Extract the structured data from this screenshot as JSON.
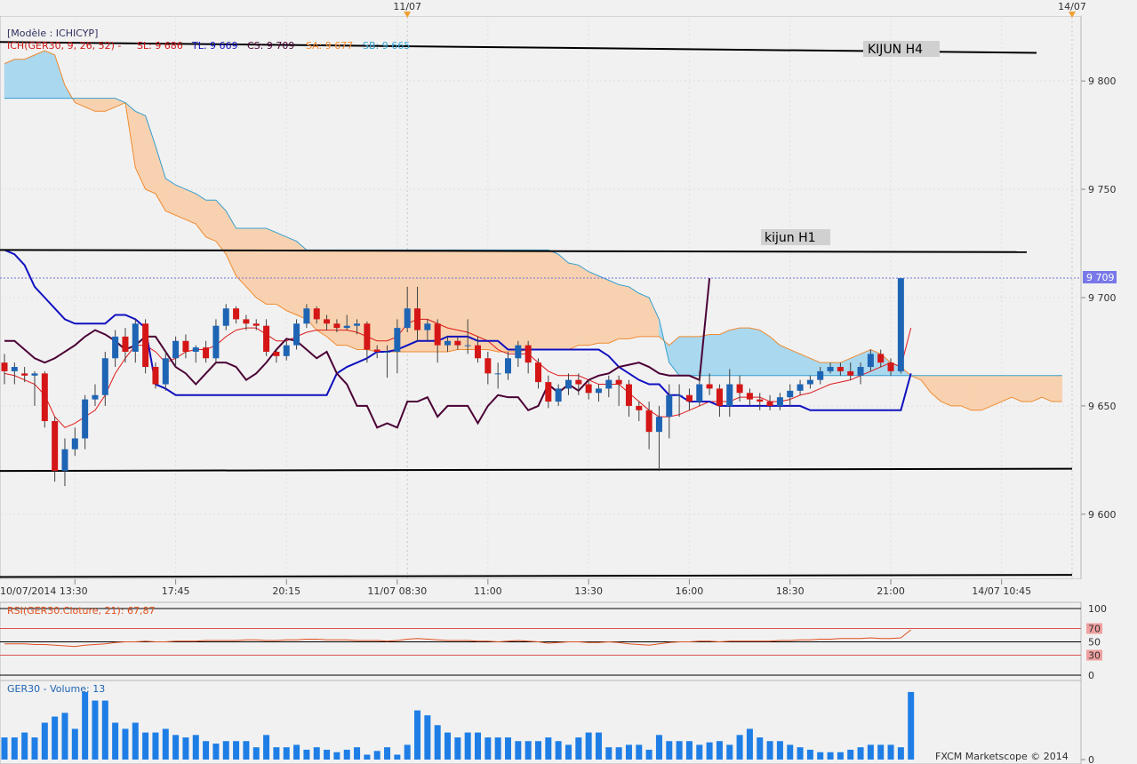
{
  "top_dates": [
    {
      "label": "11/07",
      "index": 40
    },
    {
      "label": "14/07",
      "index": 106
    }
  ],
  "legend": {
    "model": "[Modèle : ICHICYP]",
    "ich_params": "ICH(GER30, 9, 26, 52) -",
    "sl": "SL: 9 686",
    "tl": "TL: 9 669",
    "cs": "CS: 9 709",
    "sa": "SA: 9 677",
    "sb": "SB: 9 665"
  },
  "annotations": {
    "kijun_h4": "KIJUN H4",
    "kijun_h1": "kijun H1"
  },
  "price_axis": {
    "ticks": [
      "9 800",
      "9 750",
      "9 700",
      "9 650",
      "9 600"
    ],
    "current_label": "9 709"
  },
  "time_axis": [
    "10/07/2014 13:30",
    "17:45",
    "20:15",
    "11/07 08:30",
    "11:00",
    "13:30",
    "16:00",
    "18:30",
    "21:00",
    "14/07 10:45"
  ],
  "rsi": {
    "title": "RSI(GER30.Cloture, 21): 67,87",
    "levels": [
      "100",
      "70",
      "50",
      "30",
      "0"
    ]
  },
  "volume": {
    "title": "GER30 - Volume: 13"
  },
  "copyright": "FXCM Marketscope © 2014",
  "colors": {
    "bull": "#1e64b4",
    "bear": "#d51616",
    "tenkan": "#e01818",
    "kijun": "#1010c0",
    "chikou": "#4b0036",
    "senkou_a": "#f08a30",
    "senkou_b": "#38a0d0",
    "cloud_bear": "#f8d2b0",
    "cloud_bull": "#aad8ee",
    "volume": "#1e7ee6"
  },
  "chart_data": {
    "type": "candlestick",
    "symbol": "GER30",
    "y_range": [
      9570,
      9830
    ],
    "candles": [
      [
        9670,
        9674,
        9660,
        9666
      ],
      [
        9666,
        9670,
        9660,
        9668
      ],
      [
        9665,
        9668,
        9661,
        9664
      ],
      [
        9664,
        9666,
        9650,
        9665
      ],
      [
        9665,
        9666,
        9640,
        9643
      ],
      [
        9643,
        9645,
        9615,
        9620
      ],
      [
        9620,
        9635,
        9613,
        9630
      ],
      [
        9630,
        9640,
        9627,
        9635
      ],
      [
        9635,
        9655,
        9630,
        9653
      ],
      [
        9653,
        9660,
        9650,
        9655
      ],
      [
        9655,
        9675,
        9650,
        9672
      ],
      [
        9672,
        9685,
        9668,
        9682
      ],
      [
        9682,
        9686,
        9670,
        9675
      ],
      [
        9675,
        9690,
        9670,
        9688
      ],
      [
        9688,
        9690,
        9665,
        9668
      ],
      [
        9668,
        9670,
        9658,
        9660
      ],
      [
        9660,
        9675,
        9657,
        9672
      ],
      [
        9672,
        9682,
        9668,
        9680
      ],
      [
        9680,
        9683,
        9672,
        9675
      ],
      [
        9675,
        9678,
        9670,
        9677
      ],
      [
        9677,
        9680,
        9670,
        9672
      ],
      [
        9672,
        9690,
        9670,
        9687
      ],
      [
        9687,
        9697,
        9685,
        9695
      ],
      [
        9695,
        9696,
        9688,
        9690
      ],
      [
        9690,
        9692,
        9685,
        9688
      ],
      [
        9688,
        9690,
        9685,
        9687
      ],
      [
        9687,
        9690,
        9673,
        9675
      ],
      [
        9675,
        9676,
        9670,
        9673
      ],
      [
        9673,
        9680,
        9671,
        9678
      ],
      [
        9678,
        9690,
        9676,
        9688
      ],
      [
        9688,
        9697,
        9686,
        9695
      ],
      [
        9695,
        9696,
        9688,
        9690
      ],
      [
        9690,
        9692,
        9685,
        9688
      ],
      [
        9688,
        9690,
        9684,
        9686
      ],
      [
        9686,
        9692,
        9685,
        9687
      ],
      [
        9687,
        9690,
        9683,
        9688
      ],
      [
        9688,
        9689,
        9670,
        9676
      ],
      [
        9676,
        9678,
        9672,
        9675
      ],
      [
        9675,
        9678,
        9663,
        9675
      ],
      [
        9675,
        9690,
        9665,
        9686
      ],
      [
        9686,
        9705,
        9684,
        9695
      ],
      [
        9695,
        9705,
        9680,
        9685
      ],
      [
        9685,
        9690,
        9680,
        9688
      ],
      [
        9688,
        9690,
        9670,
        9678
      ],
      [
        9678,
        9682,
        9675,
        9680
      ],
      [
        9680,
        9682,
        9676,
        9678
      ],
      [
        9678,
        9690,
        9674,
        9678
      ],
      [
        9678,
        9682,
        9670,
        9672
      ],
      [
        9672,
        9675,
        9660,
        9665
      ],
      [
        9665,
        9670,
        9658,
        9665
      ],
      [
        9665,
        9675,
        9662,
        9672
      ],
      [
        9672,
        9680,
        9668,
        9678
      ],
      [
        9678,
        9680,
        9665,
        9670
      ],
      [
        9670,
        9672,
        9658,
        9661
      ],
      [
        9661,
        9664,
        9649,
        9652
      ],
      [
        9652,
        9660,
        9650,
        9658
      ],
      [
        9658,
        9665,
        9655,
        9662
      ],
      [
        9662,
        9665,
        9655,
        9660
      ],
      [
        9660,
        9662,
        9653,
        9656
      ],
      [
        9656,
        9660,
        9652,
        9658
      ],
      [
        9658,
        9664,
        9654,
        9662
      ],
      [
        9662,
        9664,
        9650,
        9660
      ],
      [
        9660,
        9662,
        9645,
        9650
      ],
      [
        9650,
        9652,
        9643,
        9648
      ],
      [
        9648,
        9652,
        9630,
        9638
      ],
      [
        9638,
        9650,
        9620,
        9645
      ],
      [
        9645,
        9660,
        9635,
        9655
      ],
      [
        9655,
        9660,
        9645,
        9655
      ],
      [
        9655,
        9658,
        9648,
        9652
      ],
      [
        9652,
        9666,
        9650,
        9660
      ],
      [
        9660,
        9665,
        9655,
        9658
      ],
      [
        9658,
        9660,
        9645,
        9650
      ],
      [
        9650,
        9667,
        9645,
        9660
      ],
      [
        9660,
        9664,
        9652,
        9656
      ],
      [
        9656,
        9658,
        9650,
        9653
      ],
      [
        9653,
        9656,
        9648,
        9652
      ],
      [
        9652,
        9655,
        9648,
        9650
      ],
      [
        9650,
        9656,
        9648,
        9654
      ],
      [
        9654,
        9660,
        9650,
        9657
      ],
      [
        9657,
        9662,
        9655,
        9660
      ],
      [
        9660,
        9664,
        9658,
        9662
      ],
      [
        9662,
        9668,
        9660,
        9666
      ],
      [
        9666,
        9670,
        9665,
        9668
      ],
      [
        9668,
        9670,
        9664,
        9666
      ],
      [
        9666,
        9670,
        9662,
        9664
      ],
      [
        9664,
        9670,
        9660,
        9668
      ],
      [
        9668,
        9676,
        9666,
        9674
      ],
      [
        9674,
        9676,
        9668,
        9670
      ],
      [
        9670,
        9672,
        9664,
        9666
      ],
      [
        9666,
        9709,
        9665,
        9709
      ]
    ],
    "tenkan": [
      9665,
      9664,
      9662,
      9660,
      9655,
      9645,
      9640,
      9642,
      9645,
      9648,
      9655,
      9665,
      9672,
      9678,
      9678,
      9675,
      9670,
      9672,
      9675,
      9676,
      9676,
      9678,
      9682,
      9685,
      9686,
      9686,
      9683,
      9680,
      9680,
      9682,
      9684,
      9685,
      9685,
      9685,
      9685,
      9684,
      9682,
      9680,
      9680,
      9682,
      9688,
      9690,
      9690,
      9688,
      9686,
      9685,
      9684,
      9682,
      9680,
      9676,
      9674,
      9674,
      9674,
      9670,
      9666,
      9664,
      9664,
      9664,
      9662,
      9660,
      9660,
      9660,
      9656,
      9652,
      9648,
      9645,
      9645,
      9646,
      9648,
      9650,
      9652,
      9652,
      9652,
      9654,
      9654,
      9654,
      9652,
      9652,
      9653,
      9655,
      9656,
      9658,
      9660,
      9661,
      9662,
      9664,
      9666,
      9668,
      9670,
      9668,
      9686
    ],
    "kijun": [
      9722,
      9720,
      9715,
      9705,
      9700,
      9695,
      9690,
      9688,
      9688,
      9688,
      9688,
      9692,
      9692,
      9690,
      9686,
      9660,
      9658,
      9655,
      9655,
      9655,
      9655,
      9655,
      9655,
      9655,
      9655,
      9655,
      9655,
      9655,
      9655,
      9655,
      9655,
      9655,
      9655,
      9665,
      9668,
      9670,
      9672,
      9675,
      9675,
      9676,
      9678,
      9680,
      9680,
      9680,
      9682,
      9682,
      9682,
      9680,
      9680,
      9680,
      9676,
      9676,
      9676,
      9676,
      9676,
      9676,
      9676,
      9676,
      9676,
      9676,
      9673,
      9668,
      9665,
      9662,
      9660,
      9660,
      9655,
      9655,
      9652,
      9652,
      9652,
      9650,
      9650,
      9650,
      9650,
      9650,
      9650,
      9650,
      9650,
      9650,
      9648,
      9648,
      9648,
      9648,
      9648,
      9648,
      9648,
      9648,
      9648,
      9648,
      9665
    ],
    "chikou": [
      9680,
      9680,
      9676,
      9672,
      9670,
      9672,
      9675,
      9678,
      9682,
      9685,
      9683,
      9680,
      9676,
      9678,
      9682,
      9682,
      9675,
      9668,
      9665,
      9660,
      9665,
      9670,
      9670,
      9668,
      9662,
      9665,
      9670,
      9676,
      9681,
      9680,
      9676,
      9672,
      9675,
      9665,
      9660,
      9650,
      9650,
      9640,
      9642,
      9640,
      9652,
      9652,
      9654,
      9645,
      9650,
      9650,
      9650,
      9642,
      9650,
      9655,
      9654,
      9654,
      9648,
      9650,
      9660,
      9656,
      9660,
      9657,
      9662,
      9664,
      9665,
      9668,
      9669,
      9670,
      9668,
      9665,
      9664,
      9664,
      9664,
      9662,
      9709
    ],
    "senkou_a": [
      9808,
      9810,
      9810,
      9812,
      9814,
      9812,
      9798,
      9790,
      9788,
      9786,
      9786,
      9788,
      9790,
      9760,
      9750,
      9748,
      9740,
      9738,
      9736,
      9734,
      9728,
      9726,
      9720,
      9710,
      9705,
      9700,
      9697,
      9697,
      9694,
      9692,
      9690,
      9685,
      9682,
      9678,
      9678,
      9676,
      9676,
      9675,
      9675,
      9675,
      9675,
      9675,
      9675,
      9675,
      9675,
      9676,
      9676,
      9676,
      9676,
      9675,
      9675,
      9675,
      9676,
      9676,
      9676,
      9676,
      9676,
      9678,
      9678,
      9679,
      9679,
      9681,
      9681,
      9682,
      9682,
      9682,
      9678,
      9682,
      9682,
      9682,
      9683,
      9683,
      9685,
      9686,
      9686,
      9685,
      9682,
      9678,
      9676,
      9674,
      9672,
      9670,
      9670,
      9670,
      9672,
      9674,
      9676,
      9674,
      9670,
      9668,
      9664,
      9662,
      9656,
      9652,
      9650,
      9650,
      9648,
      9648,
      9650,
      9652,
      9654,
      9652,
      9652,
      9654,
      9652,
      9652
    ],
    "senkou_b": [
      9792,
      9792,
      9792,
      9792,
      9792,
      9792,
      9792,
      9792,
      9792,
      9792,
      9792,
      9792,
      9790,
      9786,
      9784,
      9770,
      9755,
      9752,
      9750,
      9748,
      9745,
      9745,
      9740,
      9732,
      9732,
      9732,
      9732,
      9730,
      9728,
      9726,
      9722,
      9722,
      9722,
      9722,
      9722,
      9722,
      9722,
      9722,
      9722,
      9722,
      9722,
      9722,
      9722,
      9722,
      9722,
      9722,
      9722,
      9722,
      9722,
      9722,
      9722,
      9722,
      9722,
      9722,
      9722,
      9720,
      9716,
      9715,
      9712,
      9710,
      9708,
      9706,
      9705,
      9702,
      9700,
      9690,
      9670,
      9664,
      9664,
      9664,
      9664,
      9664,
      9664,
      9664,
      9664,
      9664,
      9664,
      9664,
      9664,
      9664,
      9664,
      9664,
      9664,
      9664,
      9664,
      9664,
      9664,
      9664,
      9664,
      9664,
      9664,
      9664,
      9664,
      9664,
      9664,
      9664,
      9664,
      9664,
      9664,
      9664,
      9664,
      9664,
      9664,
      9664,
      9664,
      9664
    ],
    "kijun_levels": [
      {
        "label": "KIJUN H4",
        "from_y": 9818,
        "to_y": 9813
      },
      {
        "label": "kijun H1",
        "from_y": 9722,
        "to_y": 9721
      },
      {
        "label": "",
        "from_y": 9620,
        "to_y": 9621
      },
      {
        "label": "",
        "from_y": 9571,
        "to_y": 9572
      }
    ],
    "current_price": 9709,
    "rsi_range": [
      0,
      100
    ],
    "rsi_levels": [
      70,
      50,
      30
    ],
    "rsi": [
      47,
      47,
      47,
      46,
      46,
      45,
      44,
      43,
      45,
      46,
      47,
      49,
      50,
      50,
      51,
      50,
      50,
      51,
      51,
      51,
      52,
      52,
      52,
      52,
      53,
      53,
      52,
      52,
      53,
      53,
      54,
      54,
      53,
      53,
      53,
      52,
      52,
      52,
      51,
      52,
      54,
      55,
      54,
      53,
      52,
      52,
      52,
      51,
      51,
      50,
      51,
      52,
      51,
      50,
      48,
      49,
      50,
      50,
      49,
      49,
      50,
      49,
      47,
      46,
      45,
      47,
      49,
      50,
      50,
      51,
      51,
      50,
      51,
      51,
      51,
      51,
      51,
      52,
      52,
      53,
      53,
      54,
      54,
      55,
      55,
      55,
      56,
      55,
      55,
      56,
      68
    ],
    "volume": [
      18,
      18,
      22,
      18,
      30,
      35,
      38,
      25,
      55,
      48,
      48,
      30,
      25,
      30,
      22,
      22,
      25,
      20,
      18,
      20,
      15,
      13,
      15,
      15,
      15,
      10,
      20,
      10,
      10,
      12,
      8,
      10,
      8,
      6,
      8,
      10,
      4,
      7,
      10,
      4,
      12,
      40,
      36,
      28,
      22,
      18,
      22,
      22,
      18,
      18,
      18,
      15,
      15,
      15,
      18,
      15,
      12,
      18,
      22,
      22,
      10,
      10,
      12,
      12,
      8,
      20,
      15,
      15,
      15,
      12,
      14,
      15,
      12,
      20,
      25,
      18,
      15,
      15,
      12,
      10,
      8,
      6,
      6,
      6,
      8,
      10,
      12,
      12,
      12,
      10,
      55
    ]
  }
}
